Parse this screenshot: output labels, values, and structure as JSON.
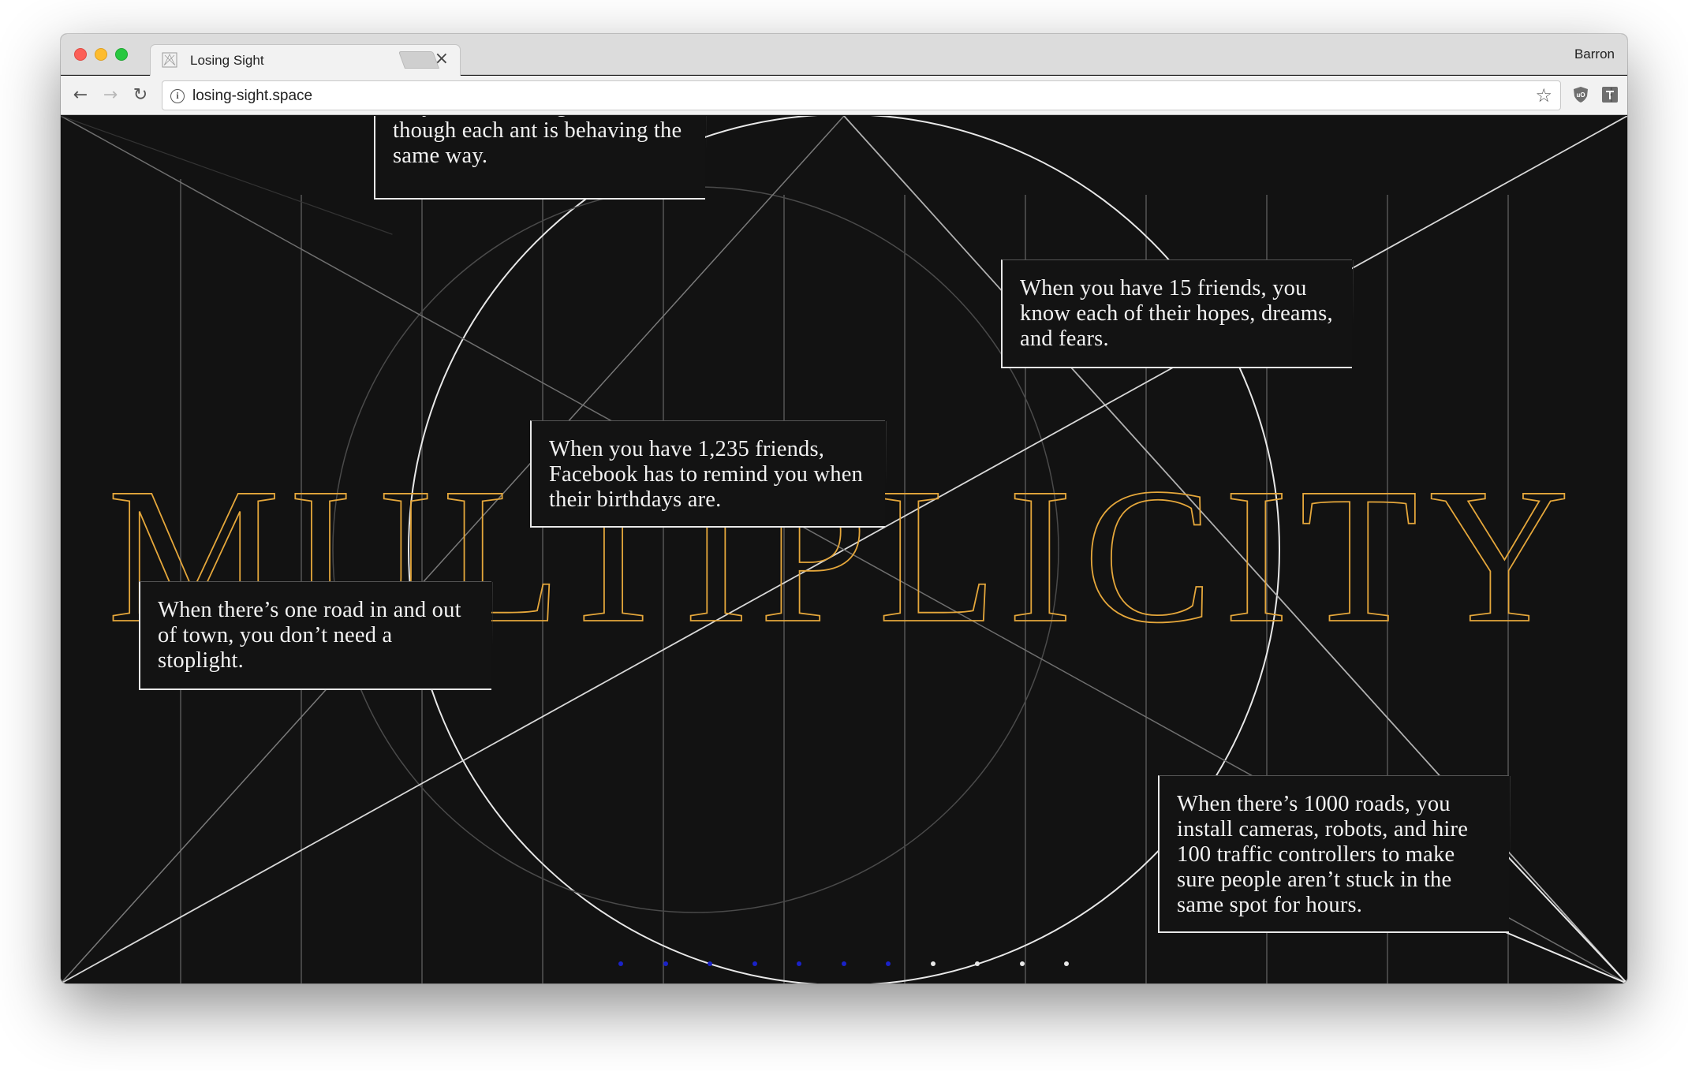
{
  "browser": {
    "tab_title": "Losing Sight",
    "tab_close": "×",
    "profile_name": "Barron",
    "url": "losing-sight.space",
    "back_glyph": "←",
    "forward_glyph": "→",
    "reload_glyph": "↻",
    "info_glyph": "i",
    "star_glyph": "☆",
    "menu_glyph": "⋮",
    "extensions": [
      "ublock-origin-icon",
      "type-sample-icon",
      "google-drive-icon"
    ]
  },
  "page": {
    "headline": "MULTIPLICITY",
    "headline_color": "#e5a73b",
    "background": "#121212",
    "cards": [
      {
        "name": "card-ants",
        "text": "only see a writhing mass, even though each ant is behaving the same way."
      },
      {
        "name": "card-fifteen-friends",
        "text": "When you have 15 friends, you know each of their hopes, dreams, and fears."
      },
      {
        "name": "card-many-friends",
        "text": "When you have 1,235 friends, Facebook has to remind you when their birthdays are."
      },
      {
        "name": "card-one-road",
        "text": "When there’s one road in and out of town, you don’t need a stoplight."
      },
      {
        "name": "card-thousand-roads",
        "text": "When there’s 1000 roads, you install cameras, robots, and hire 100 traffic controllers to make sure people aren’t stuck in the same spot for hours."
      }
    ],
    "progress": {
      "total": 11,
      "completed": 7,
      "completed_color": "#1a22c8",
      "remaining_color": "#e8e8e8"
    }
  }
}
